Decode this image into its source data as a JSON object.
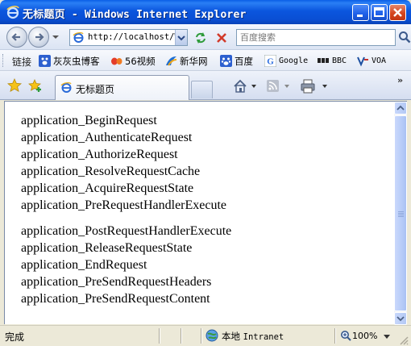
{
  "window": {
    "title": "无标题页 - Windows Internet Explorer"
  },
  "address": {
    "url": "http://localhost/W",
    "search_placeholder": "百度搜索"
  },
  "links_bar": {
    "label": "链接",
    "items": [
      {
        "label": "灰灰虫博客",
        "icon": "paw-icon"
      },
      {
        "label": "56视频",
        "icon": "56-logo-icon"
      },
      {
        "label": "新华网",
        "icon": "xinhua-icon"
      },
      {
        "label": "百度",
        "icon": "baidu-paw-icon"
      },
      {
        "label": "Google",
        "icon": "google-g-icon"
      },
      {
        "label": "BBC",
        "icon": "bbc-logo-icon"
      },
      {
        "label": "VOA",
        "icon": "voa-logo-icon"
      }
    ]
  },
  "tab": {
    "label": "无标题页"
  },
  "content": {
    "group1": [
      "application_BeginRequest",
      "application_AuthenticateRequest",
      "application_AuthorizeRequest",
      "application_ResolveRequestCache",
      "application_AcquireRequestState",
      "application_PreRequestHandlerExecute"
    ],
    "group2": [
      "application_PostRequestHandlerExecute",
      "application_ReleaseRequestState",
      "application_EndRequest",
      "application_PreSendRequestHeaders",
      "application_PreSendRequestContent"
    ]
  },
  "status": {
    "text": "完成",
    "zone_cn": "本地",
    "zone_en": "Intranet",
    "zoom": "100%"
  },
  "colors": {
    "titlebar": "#0b56de",
    "accent": "#2a7ff5",
    "close_button": "#d4451e"
  }
}
